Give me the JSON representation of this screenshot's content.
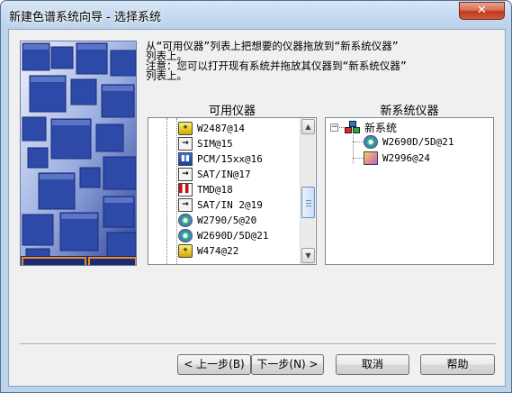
{
  "window": {
    "title": "新建色谱系统向导 - 选择系统",
    "close_glyph": "✕"
  },
  "instructions": {
    "line1": "从“可用仪器”列表上把想要的仪器拖放到“新系统仪器”",
    "line2": "列表上。",
    "line3": "注意：您可以打开现有系统并拖放其仪器到“新系统仪器”",
    "line4": "列表上。"
  },
  "available": {
    "title": "可用仪器",
    "items": [
      {
        "label": "W2487@14",
        "icon": "bulb-icon",
        "glyph": "💡"
      },
      {
        "label": "SIM@15",
        "icon": "arrow-icon",
        "glyph": "→"
      },
      {
        "label": "PCM/15xx@16",
        "icon": "pump-icon",
        "glyph": "▮▮"
      },
      {
        "label": "SAT/IN@17",
        "icon": "arrow-icon",
        "glyph": "→"
      },
      {
        "label": "TMD@18",
        "icon": "chart-icon",
        "glyph": "▌▌"
      },
      {
        "label": "SAT/IN 2@19",
        "icon": "arrow-icon",
        "glyph": "→"
      },
      {
        "label": "W2790/5@20",
        "icon": "disc-icon",
        "glyph": ""
      },
      {
        "label": "W2690D/5D@21",
        "icon": "disc-icon",
        "glyph": ""
      },
      {
        "label": "W474@22",
        "icon": "bulb-icon",
        "glyph": "💡"
      }
    ]
  },
  "new_system": {
    "title": "新系统仪器",
    "root_label": "新系统",
    "expander": "−",
    "children": [
      {
        "label": "W2690D/5D@21",
        "icon": "disc-icon"
      },
      {
        "label": "W2996@24",
        "icon": "pda-icon"
      }
    ]
  },
  "buttons": {
    "back": "< 上一步(B)",
    "next": "下一步(N) >",
    "cancel": "取消",
    "help": "帮助"
  },
  "scrollbar": {
    "up": "▲",
    "down": "▼"
  }
}
